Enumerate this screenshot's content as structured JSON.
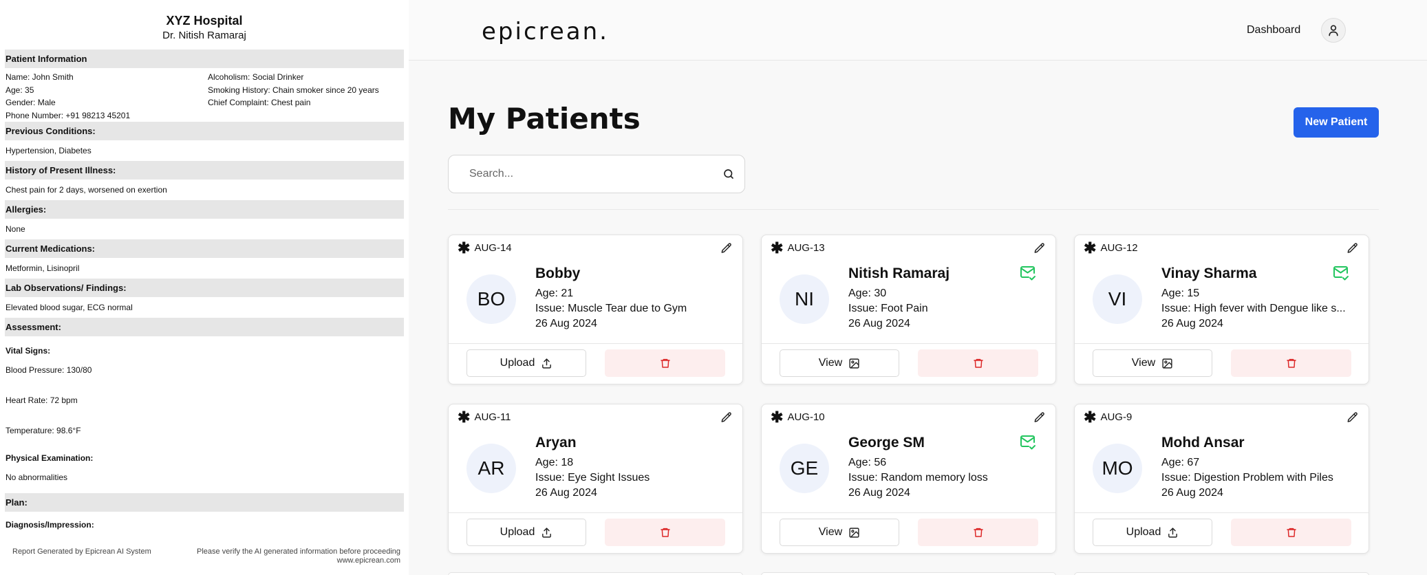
{
  "report": {
    "hospital": "XYZ Hospital",
    "doctor": "Dr. Nitish Ramaraj",
    "patient_info_heading": "Patient Information",
    "patient_info_left": [
      "Name: John Smith",
      "Age: 35",
      "Gender: Male",
      "Phone Number: +91 98213 45201"
    ],
    "patient_info_right": [
      "Alcoholism: Social Drinker",
      "Smoking History: Chain smoker since 20 years",
      "Chief Complaint: Chest pain"
    ],
    "previous_conditions": {
      "heading": "Previous Conditions:",
      "value": "Hypertension, Diabetes"
    },
    "history": {
      "heading": "History of Present Illness:",
      "value": "Chest pain for 2 days, worsened on exertion"
    },
    "allergies": {
      "heading": "Allergies:",
      "value": "None"
    },
    "medications": {
      "heading": "Current Medications:",
      "value": "Metformin, Lisinopril"
    },
    "lab": {
      "heading": "Lab Observations/ Findings:",
      "value": "Elevated blood sugar, ECG normal"
    },
    "assessment": {
      "heading": "Assessment:"
    },
    "vital_signs_label": "Vital Signs:",
    "blood_pressure": "Blood Pressure: 130/80",
    "heart_rate": "Heart Rate: 72 bpm",
    "temperature": "Temperature: 98.6°F",
    "physical_exam_label": "Physical Examination:",
    "physical_exam_value": "No abnormalities",
    "plan": {
      "heading": "Plan:"
    },
    "diagnosis_label": "Diagnosis/Impression:",
    "footer_left": "Report Generated by Epicrean AI System",
    "footer_right_1": "Please verify the AI generated information before proceeding",
    "footer_right_2": "www.epicrean.com"
  },
  "app": {
    "logo": "epicrean.",
    "nav_dashboard": "Dashboard",
    "page_title": "My Patients",
    "new_patient_label": "New Patient",
    "search_placeholder": "Search...",
    "colors": {
      "accent": "#2563eb",
      "mail_green": "#22c55e",
      "delete_red": "#dc2626",
      "delete_bg": "#fdeeee",
      "avatar_bg": "#eef2fb"
    }
  },
  "patients": [
    {
      "id": "AUG-14",
      "initials": "BO",
      "name": "Bobby",
      "age": "Age: 21",
      "issue": "Issue: Muscle Tear due to Gym",
      "date": "26 Aug 2024",
      "action": "Upload",
      "action_icon": "upload-icon",
      "has_mail": false
    },
    {
      "id": "AUG-13",
      "initials": "NI",
      "name": "Nitish Ramaraj",
      "age": "Age: 30",
      "issue": "Issue: Foot Pain",
      "date": "26 Aug 2024",
      "action": "View",
      "action_icon": "image-icon",
      "has_mail": true
    },
    {
      "id": "AUG-12",
      "initials": "VI",
      "name": "Vinay Sharma",
      "age": "Age: 15",
      "issue": "Issue: High fever with Dengue like s...",
      "date": "26 Aug 2024",
      "action": "View",
      "action_icon": "image-icon",
      "has_mail": true
    },
    {
      "id": "AUG-11",
      "initials": "AR",
      "name": "Aryan",
      "age": "Age: 18",
      "issue": "Issue: Eye Sight Issues",
      "date": "26 Aug 2024",
      "action": "Upload",
      "action_icon": "upload-icon",
      "has_mail": false
    },
    {
      "id": "AUG-10",
      "initials": "GE",
      "name": "George SM",
      "age": "Age: 56",
      "issue": "Issue: Random memory loss",
      "date": "26 Aug 2024",
      "action": "View",
      "action_icon": "image-icon",
      "has_mail": true
    },
    {
      "id": "AUG-9",
      "initials": "MO",
      "name": "Mohd Ansar",
      "age": "Age: 67",
      "issue": "Issue: Digestion Problem with Piles",
      "date": "26 Aug 2024",
      "action": "Upload",
      "action_icon": "upload-icon",
      "has_mail": false
    }
  ]
}
